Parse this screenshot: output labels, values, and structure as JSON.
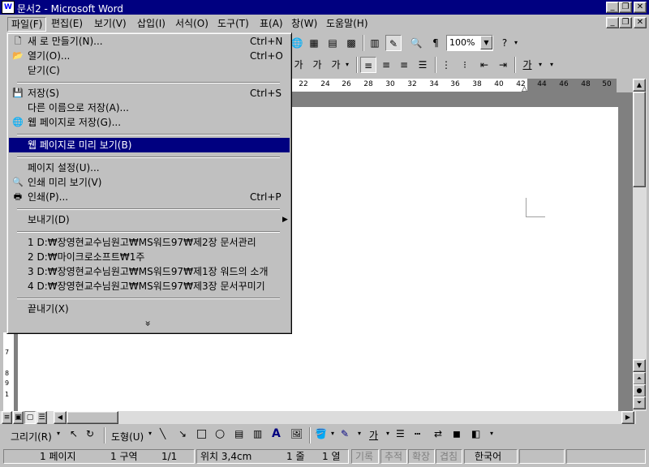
{
  "window": {
    "title": "문서2 - Microsoft Word",
    "app_icon": "W",
    "controls": [
      "minimize-icon",
      "restore-icon",
      "close-icon"
    ]
  },
  "menubar": {
    "items": [
      "파일(F)",
      "편집(E)",
      "보기(V)",
      "삽입(I)",
      "서식(O)",
      "도구(T)",
      "표(A)",
      "창(W)",
      "도움말(H)"
    ],
    "active": "파일(F)"
  },
  "toolbar": {
    "zoom": "100%"
  },
  "ruler": {
    "numbers": [
      "22",
      "24",
      "26",
      "28",
      "30",
      "32",
      "34",
      "36",
      "38",
      "40",
      "42",
      "44",
      "46",
      "48",
      "50"
    ]
  },
  "vertical_ruler": {
    "numbers": [
      "7",
      "8",
      "9",
      "1"
    ]
  },
  "file_menu": {
    "items": [
      {
        "label": "새 로 만들기(N)...",
        "shortcut": "Ctrl+N",
        "icon": "new-document-icon"
      },
      {
        "label": "열기(O)...",
        "shortcut": "Ctrl+O",
        "icon": "open-folder-icon"
      },
      {
        "label": "닫기(C)",
        "shortcut": "",
        "icon": ""
      },
      {
        "label": "저장(S)",
        "shortcut": "Ctrl+S",
        "icon": "save-disk-icon"
      },
      {
        "label": "다른 이름으로 저장(A)...",
        "shortcut": "",
        "icon": ""
      },
      {
        "label": "웹 페이지로 저장(G)...",
        "shortcut": "",
        "icon": "save-web-icon"
      },
      {
        "label": "웹 페이지로 미리 보기(B)",
        "shortcut": "",
        "icon": ""
      },
      {
        "label": "페이지 설정(U)...",
        "shortcut": "",
        "icon": ""
      },
      {
        "label": "인쇄 미리 보기(V)",
        "shortcut": "",
        "icon": "print-preview-icon"
      },
      {
        "label": "인쇄(P)...",
        "shortcut": "Ctrl+P",
        "icon": "printer-icon"
      },
      {
        "label": "보내기(D)",
        "shortcut": "",
        "icon": ""
      },
      {
        "label": "1 D:₩장영현교수님원고₩MS워드97₩제2장 문서관리",
        "shortcut": "",
        "icon": ""
      },
      {
        "label": "2 D:₩마이크로소프트₩1주",
        "shortcut": "",
        "icon": ""
      },
      {
        "label": "3 D:₩장영현교수님원고₩MS워드97₩제1장 워드의 소개",
        "shortcut": "",
        "icon": ""
      },
      {
        "label": "4 D:₩장영현교수님원고₩MS워드97₩제3장 문서꾸미기",
        "shortcut": "",
        "icon": ""
      },
      {
        "label": "끝내기(X)",
        "shortcut": "",
        "icon": ""
      }
    ],
    "highlighted": "웹 페이지로 미리 보기(B)",
    "expand_glyph": "»"
  },
  "format_toolbar": {
    "char_shade": "가",
    "char_border": "가",
    "phonetic": "가",
    "font_color": "가"
  },
  "drawing_toolbar": {
    "draw_label": "그리기(R)",
    "autoshapes_label": "도형(U)",
    "font_color": "가"
  },
  "statusbar": {
    "page": "1 페이지",
    "section": "1 구역",
    "page_of": "1/1",
    "position": "위치 3,4cm",
    "line": "1 줄",
    "column": "1 열",
    "rec": "기록",
    "trk": "추적",
    "ext": "확장",
    "ovr": "겹침",
    "language": "한국어"
  }
}
